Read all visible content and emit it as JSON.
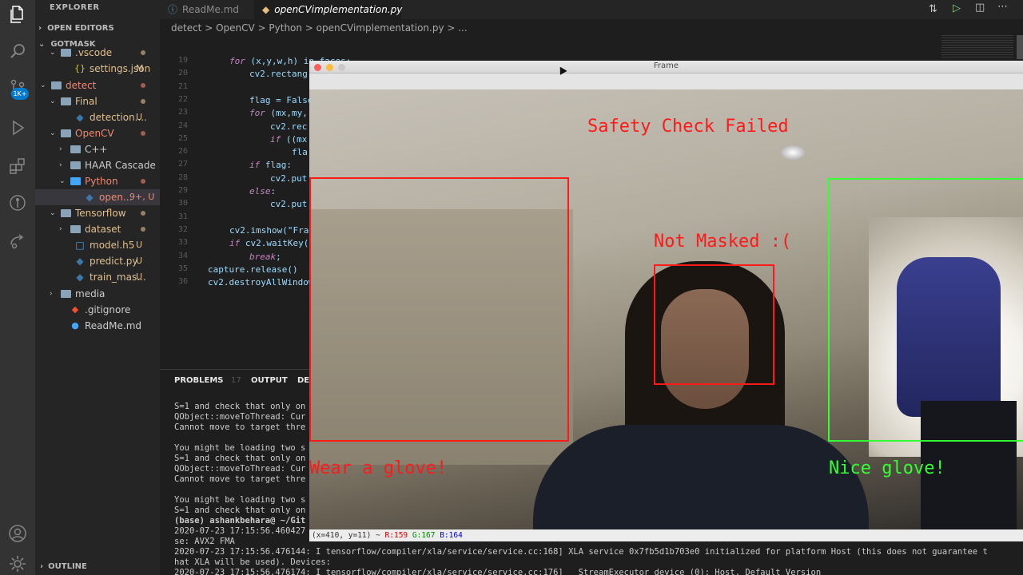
{
  "sidebar": {
    "title": "EXPLORER",
    "open_editors": "OPEN EDITORS",
    "workspace": "GOTMASK",
    "outline": "OUTLINE",
    "activity_badge": "1K+",
    "tree": [
      {
        "label": ".vscode",
        "badge": "",
        "color": "#e2c08d"
      },
      {
        "label": "settings.json",
        "badge": "M",
        "color": "#e2c08d"
      },
      {
        "label": "detect",
        "badge": "",
        "color": "#f48771"
      },
      {
        "label": "Final",
        "badge": "",
        "color": "#e2c08d"
      },
      {
        "label": "detection....",
        "badge": "U",
        "color": "#e2c08d"
      },
      {
        "label": "OpenCV",
        "badge": "",
        "color": "#f48771"
      },
      {
        "label": "C++",
        "badge": "",
        "color": "#cccccc"
      },
      {
        "label": "HAAR Cascade",
        "badge": "",
        "color": "#cccccc"
      },
      {
        "label": "Python",
        "badge": "",
        "color": "#f48771"
      },
      {
        "label": "open...",
        "badge": "9+, U",
        "color": "#f48771"
      },
      {
        "label": "Tensorflow",
        "badge": "",
        "color": "#e2c08d"
      },
      {
        "label": "dataset",
        "badge": "",
        "color": "#e2c08d"
      },
      {
        "label": "model.h5",
        "badge": "U",
        "color": "#e2c08d"
      },
      {
        "label": "predict.py",
        "badge": "U",
        "color": "#e2c08d"
      },
      {
        "label": "train_mas...",
        "badge": "U",
        "color": "#e2c08d"
      },
      {
        "label": "media",
        "badge": "",
        "color": "#cccccc"
      },
      {
        "label": ".gitignore",
        "badge": "",
        "color": "#cccccc"
      },
      {
        "label": "ReadMe.md",
        "badge": "",
        "color": "#cccccc"
      }
    ]
  },
  "tabs": [
    {
      "label": "ReadMe.md"
    },
    {
      "label": "openCVimplementation.py"
    }
  ],
  "breadcrumb": "detect > OpenCV > Python > openCVimplementation.py > ...",
  "editor": {
    "line_numbers": [
      "19",
      "20",
      "21",
      "22",
      "23",
      "24",
      "25",
      "26",
      "27",
      "28",
      "29",
      "30",
      "31",
      "32",
      "33",
      "34",
      "35",
      "36"
    ],
    "lines": [
      {
        "kw": "for",
        "rest": " (x,y,w,h) in faces:"
      },
      {
        "kw": "",
        "rest": "cv2.rectang"
      },
      {
        "kw": "",
        "rest": ""
      },
      {
        "kw": "",
        "rest": "flag = False"
      },
      {
        "kw": "for",
        "rest": " (mx,my,"
      },
      {
        "kw": "",
        "rest": "cv2.rec"
      },
      {
        "kw": "if",
        "rest": " ((mx"
      },
      {
        "kw": "",
        "rest": "fla"
      },
      {
        "kw": "if",
        "rest": " flag:"
      },
      {
        "kw": "",
        "rest": "cv2.put"
      },
      {
        "kw": "else",
        "rest": ":"
      },
      {
        "kw": "",
        "rest": "cv2.put"
      },
      {
        "kw": "",
        "rest": ""
      },
      {
        "kw": "",
        "rest": "cv2.imshow(\"Fram"
      },
      {
        "kw": "if",
        "rest": " cv2.waitKey("
      },
      {
        "kw": "break",
        "rest": ";"
      },
      {
        "kw": "",
        "rest": "capture.release()"
      },
      {
        "kw": "",
        "rest": "cv2.destroyAllWindow"
      }
    ]
  },
  "panel": {
    "tabs": [
      "PROBLEMS",
      "OUTPUT",
      "DEB"
    ],
    "problems_count": "17",
    "terminal": [
      "S=1 and check that only on",
      "QObject::moveToThread: Cur",
      "Cannot move to target thre",
      "",
      "You might be loading two s",
      "S=1 and check that only on",
      "QObject::moveToThread: Cur",
      "Cannot move to target thre",
      "",
      "You might be loading two s",
      "S=1 and check that only on",
      "(base) ashankbehara@ ~/Git",
      "2020-07-23 17:15:56.460427",
      "se: AVX2 FMA",
      "2020-07-23 17:15:56.476144: I tensorflow/compiler/xla/service/service.cc:168] XLA service 0x7fb5d1b703e0 initialized for platform Host (this does not guarantee t",
      "hat XLA will be used). Devices:",
      "2020-07-23 17:15:56.476174: I tensorflow/compiler/xla/service/service.cc:176]   StreamExecutor device (0): Host, Default Version"
    ]
  },
  "frame": {
    "title": "Frame",
    "status_coords": "(x=410, y=11) ~",
    "status_r": "R:159",
    "status_g": "G:167",
    "status_b": "B:164",
    "overlays": {
      "safety": "Safety Check Failed",
      "not_masked": "Not Masked :(",
      "wear_glove": "Wear a glove!",
      "nice_glove": "Nice glove!"
    },
    "colors": {
      "red": "#ff1a1a",
      "green": "#33ff33"
    }
  }
}
